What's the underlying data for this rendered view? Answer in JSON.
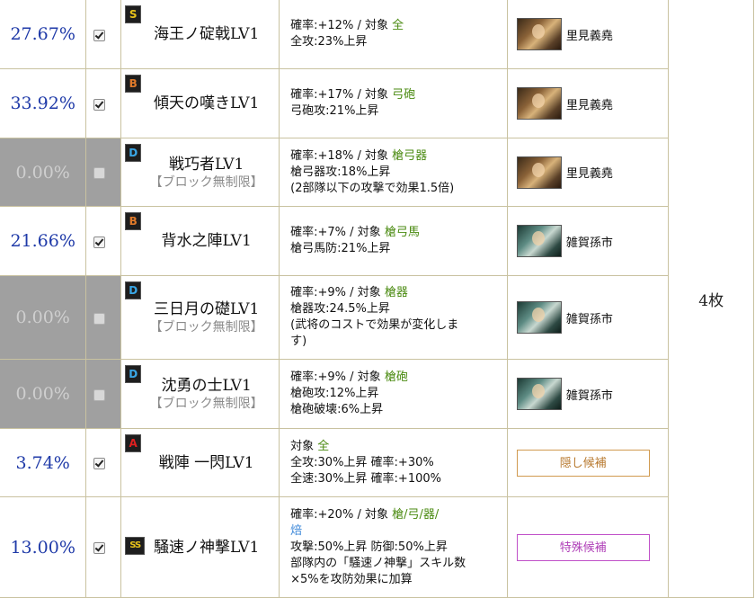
{
  "count_label": "4枚",
  "rows": [
    {
      "percent": "27.67%",
      "rank": "S",
      "skill": "海王ノ碇戟LV1",
      "desc1_pre": "確率:+12% / 対象 ",
      "target": "全",
      "desc2": "全攻:23%上昇",
      "general": "里見義堯"
    },
    {
      "percent": "33.92%",
      "rank": "B",
      "skill": "傾天の嘆きLV1",
      "desc1_pre": "確率:+17% / 対象 ",
      "target": "弓砲",
      "desc2": "弓砲攻:21%上昇",
      "general": "里見義堯"
    },
    {
      "percent": "0.00%",
      "rank": "D",
      "skill": "戦巧者LV1",
      "message": "【ブロック無制限】",
      "desc1_pre": "確率:+18% / 対象 ",
      "target": "槍弓器",
      "desc2": "槍弓器攻:18%上昇",
      "desc3": "(2部隊以下の攻撃で効果1.5倍)",
      "general": "里見義堯"
    },
    {
      "percent": "21.66%",
      "rank": "B",
      "skill": "背水之陣LV1",
      "desc1_pre": "確率:+7% / 対象 ",
      "target": "槍弓馬",
      "desc2": "槍弓馬防:21%上昇",
      "general": "雑賀孫市"
    },
    {
      "percent": "0.00%",
      "rank": "D",
      "skill": "三日月の礎LV1",
      "message": "【ブロック無制限】",
      "desc1_pre": "確率:+9% / 対象 ",
      "target": "槍器",
      "desc2": "槍器攻:24.5%上昇",
      "desc3": "(武将のコストで効果が変化しま",
      "desc4": "す)",
      "general": "雑賀孫市"
    },
    {
      "percent": "0.00%",
      "rank": "D",
      "skill": "沈勇の士LV1",
      "message": "【ブロック無制限】",
      "desc1_pre": "確率:+9% / 対象 ",
      "target": "槍砲",
      "desc2": "槍砲攻:12%上昇",
      "desc3": "槍砲破壊:6%上昇",
      "general": "雑賀孫市"
    },
    {
      "percent": "3.74%",
      "rank": "A",
      "skill": "戦陣 一閃LV1",
      "desc1_pre": "対象 ",
      "target": "全",
      "desc2": "全攻:30%上昇 確率:+30%",
      "desc3": "全速:30%上昇 確率:+100%",
      "button": "隠し候補"
    },
    {
      "percent": "13.00%",
      "rank": "SS",
      "skill": "騒速ノ神撃LV1",
      "desc1_pre": "確率:+20% / 対象 ",
      "target": "槍/弓/器/",
      "target2": "焙",
      "desc2": "攻撃:50%上昇 防御:50%上昇",
      "desc3": "部隊内の「騒速ノ神撃」スキル数",
      "desc4": "×5%を攻防効果に加算",
      "button": "特殊候補"
    }
  ]
}
